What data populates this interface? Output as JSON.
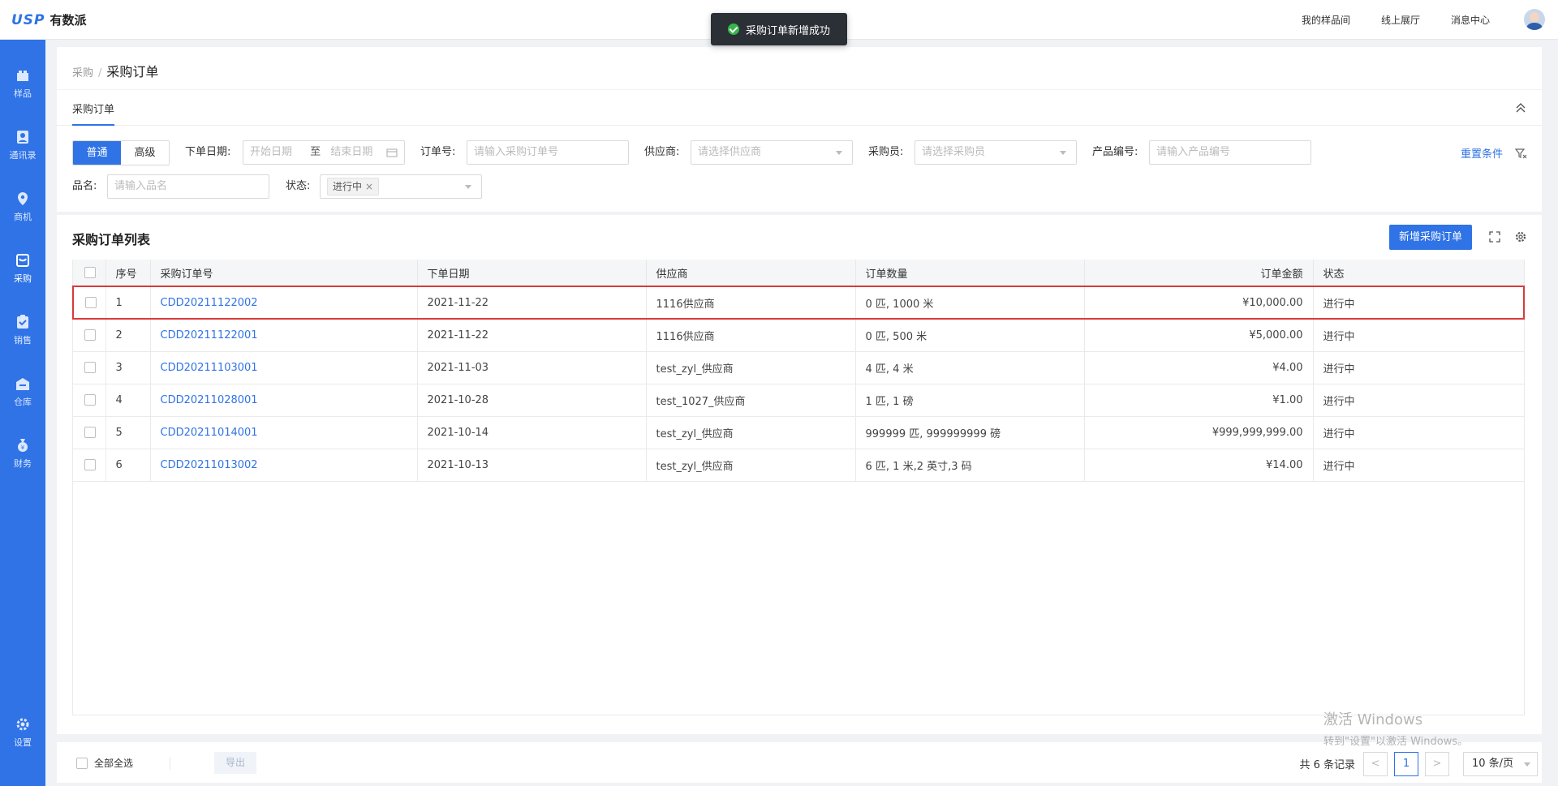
{
  "header": {
    "logo_mark": "USP",
    "logo_text": "有数派",
    "links": [
      "我的样品间",
      "线上展厅",
      "消息中心"
    ]
  },
  "toast": {
    "message": "采购订单新增成功"
  },
  "sidebar": {
    "items": [
      {
        "label": "样品",
        "icon": "box-icon"
      },
      {
        "label": "通讯录",
        "icon": "contacts-icon"
      },
      {
        "label": "商机",
        "icon": "location-icon"
      },
      {
        "label": "采购",
        "icon": "cart-icon",
        "active": true
      },
      {
        "label": "销售",
        "icon": "clipboard-icon"
      },
      {
        "label": "仓库",
        "icon": "warehouse-icon"
      },
      {
        "label": "财务",
        "icon": "money-bag-icon"
      }
    ],
    "settings_label": "设置"
  },
  "breadcrumb": {
    "parent": "采购",
    "current": "采购订单"
  },
  "filters": {
    "tab": "采购订单",
    "mode_normal": "普通",
    "mode_advanced": "高级",
    "date_label": "下单日期:",
    "date_start_placeholder": "开始日期",
    "date_to": "至",
    "date_end_placeholder": "结束日期",
    "order_no_label": "订单号:",
    "order_no_placeholder": "请输入采购订单号",
    "supplier_label": "供应商:",
    "supplier_placeholder": "请选择供应商",
    "buyer_label": "采购员:",
    "buyer_placeholder": "请选择采购员",
    "product_no_label": "产品编号:",
    "product_no_placeholder": "请输入产品编号",
    "name_label": "品名:",
    "name_placeholder": "请输入品名",
    "status_label": "状态:",
    "status_tag": "进行中",
    "reset": "重置条件"
  },
  "list": {
    "title": "采购订单列表",
    "add_button": "新增采购订单",
    "columns": [
      "序号",
      "采购订单号",
      "下单日期",
      "供应商",
      "订单数量",
      "订单金额",
      "状态"
    ],
    "rows": [
      {
        "seq": "1",
        "order_no": "CDD20211122002",
        "date": "2021-11-22",
        "supplier": "1116供应商",
        "qty": "0 匹, 1000 米",
        "amount": "¥10,000.00",
        "status": "进行中"
      },
      {
        "seq": "2",
        "order_no": "CDD20211122001",
        "date": "2021-11-22",
        "supplier": "1116供应商",
        "qty": "0 匹, 500 米",
        "amount": "¥5,000.00",
        "status": "进行中"
      },
      {
        "seq": "3",
        "order_no": "CDD20211103001",
        "date": "2021-11-03",
        "supplier": "test_zyl_供应商",
        "qty": "4 匹, 4 米",
        "amount": "¥4.00",
        "status": "进行中"
      },
      {
        "seq": "4",
        "order_no": "CDD20211028001",
        "date": "2021-10-28",
        "supplier": "test_1027_供应商",
        "qty": "1 匹, 1 磅",
        "amount": "¥1.00",
        "status": "进行中"
      },
      {
        "seq": "5",
        "order_no": "CDD20211014001",
        "date": "2021-10-14",
        "supplier": "test_zyl_供应商",
        "qty": "999999 匹, 999999999 磅",
        "amount": "¥999,999,999.00",
        "status": "进行中"
      },
      {
        "seq": "6",
        "order_no": "CDD20211013002",
        "date": "2021-10-13",
        "supplier": "test_zyl_供应商",
        "qty": "6 匹, 1 米,2 英寸,3 码",
        "amount": "¥14.00",
        "status": "进行中"
      }
    ]
  },
  "footer": {
    "select_all": "全部全选",
    "export": "导出",
    "total": "共 6 条记录",
    "page_prev": "<",
    "current_page": "1",
    "page_next": ">",
    "page_size": "10 条/页"
  },
  "watermark": {
    "line1": "激活 Windows",
    "line2": "转到\"设置\"以激活 Windows。"
  },
  "colors": {
    "primary": "#2f73e6",
    "highlight": "#d93a3a",
    "success": "#35b64a"
  }
}
